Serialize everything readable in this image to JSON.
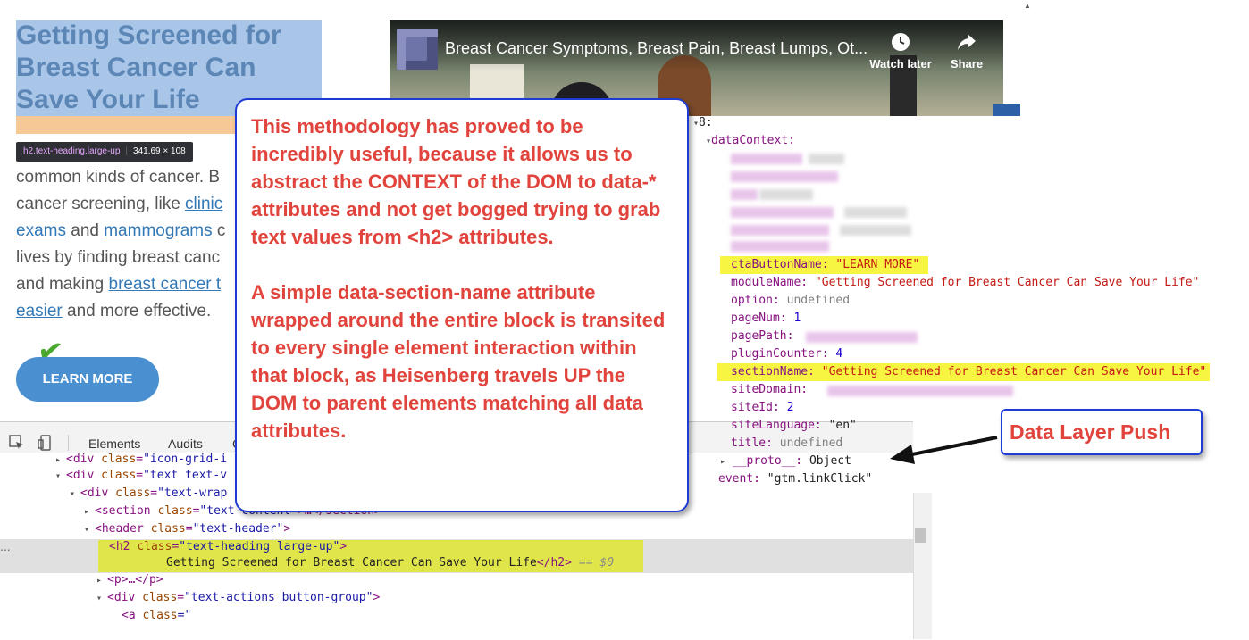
{
  "page": {
    "heading": "Getting Screened for Breast Cancer Can Save Your Life",
    "tooltip_selector": "h2.text-heading.large-up",
    "tooltip_size": "341.69 × 108",
    "paragraph": {
      "l1_text": "common kinds of cancer. B",
      "l2_text": "cancer screening, like ",
      "l2_link": "clinic",
      "l3_link": "exams",
      "l3_text": " and ",
      "l3_link2": "mammograms",
      "l3_tail": " c",
      "l4_text": "lives by finding breast canc",
      "l5_text": "and making ",
      "l5_link": "breast cancer t",
      "l6_link": "easier",
      "l6_text": " and more effective."
    },
    "cta_label": "LEARN MORE"
  },
  "video": {
    "title": "Breast Cancer Symptoms, Breast Pain, Breast Lumps, Ot...",
    "watch_later": "Watch later",
    "share": "Share"
  },
  "devtools": {
    "tabs": [
      "Elements",
      "Audits"
    ],
    "lines": {
      "l0": {
        "tag_open": "<div ",
        "attr": "class",
        "val": "\"icon-grid-i",
        "extra": ""
      },
      "l1": {
        "tag_open": "<div ",
        "attr": "class",
        "val": "\"text text-v"
      },
      "l2": {
        "tag_open": "<div ",
        "attr": "class",
        "val": "\"text-wrap"
      },
      "l3": {
        "tag_open": "<section ",
        "attr": "class",
        "val": "\"text-content",
        "tail": "\">…</section>"
      },
      "l4": {
        "tag_open": "<header ",
        "attr": "class",
        "val": "\"text-header\"",
        "tag_close": ">"
      },
      "l5": {
        "tag_open": "<h2 ",
        "attr": "class",
        "val": "\"text-heading large-up\"",
        "tag_close": ">"
      },
      "l6": {
        "text": "Getting Screened for Breast Cancer Can Save Your Life",
        "tag_close": "</h2>",
        "eq": " == $0"
      },
      "l7": {
        "text": "<p>…</p>"
      },
      "l8": {
        "tag_open": "<div ",
        "attr": "class",
        "val": "\"text-actions button-group\"",
        "tag_close": ">"
      },
      "l9": {
        "tag_open": "<a ",
        "attr": "class",
        "val": "=\""
      }
    }
  },
  "console": {
    "index": "8:",
    "dataContext_key": "dataContext:",
    "ctaButtonName_key": "ctaButtonName:",
    "ctaButtonName_val": "\"LEARN MORE\"",
    "moduleName_key": "moduleName:",
    "moduleName_val": "\"Getting Screened for Breast Cancer Can Save Your Life\"",
    "option_key": "option:",
    "option_val": "undefined",
    "pageNum_key": "pageNum:",
    "pageNum_val": "1",
    "pagePath_key": "pagePath:",
    "pluginCounter_key": "pluginCounter:",
    "pluginCounter_val": "4",
    "sectionName_key": "sectionName:",
    "sectionName_val": "\"Getting Screened for Breast Cancer Can Save Your Life\"",
    "siteDomain_key": "siteDomain:",
    "siteId_key": "siteId:",
    "siteId_val": "2",
    "siteLanguage_key": "siteLanguage:",
    "siteLanguage_val": "\"en\"",
    "title_key": "title:",
    "title_val": "undefined",
    "proto_key": "__proto__:",
    "proto_val": "Object",
    "event_key": "event:",
    "event_val": "\"gtm.linkClick\""
  },
  "callouts": {
    "main_p1": "This methodology has proved to be incredibly useful, because it allows us to abstract the CONTEXT of the DOM to data-* attributes and not get bogged trying to grab text values from <h2> attributes.",
    "main_p2": "A simple data-section-name attribute wrapped around the entire block is transited to every single element interaction within that block, as Heisenberg travels UP the DOM to parent elements matching all data attributes.",
    "data_layer": "Data Layer Push"
  }
}
